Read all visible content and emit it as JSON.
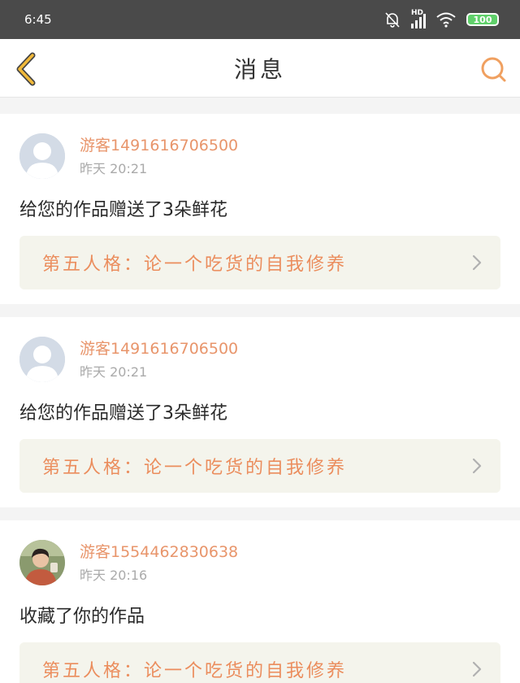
{
  "status_bar": {
    "time": "6:45",
    "network": "HD",
    "battery": "100"
  },
  "header": {
    "title": "消息",
    "back_icon": "back-chevron-icon",
    "search_icon": "search-icon"
  },
  "colors": {
    "accent": "#e8956b",
    "header_icon": "#f1b93a",
    "search": "#f0a060"
  },
  "notifications": [
    {
      "username": "游客1491616706500",
      "time": "昨天 20:21",
      "message": "给您的作品赠送了3朵鲜花",
      "work_title": "第五人格：论一个吃货的自我修养",
      "avatar": "default-avatar"
    },
    {
      "username": "游客1491616706500",
      "time": "昨天 20:21",
      "message": "给您的作品赠送了3朵鲜花",
      "work_title": "第五人格：论一个吃货的自我修养",
      "avatar": "default-avatar"
    },
    {
      "username": "游客1554462830638",
      "time": "昨天 20:16",
      "message": "收藏了你的作品",
      "work_title": "第五人格：论一个吃货的自我修养",
      "avatar": "photo-avatar"
    }
  ]
}
